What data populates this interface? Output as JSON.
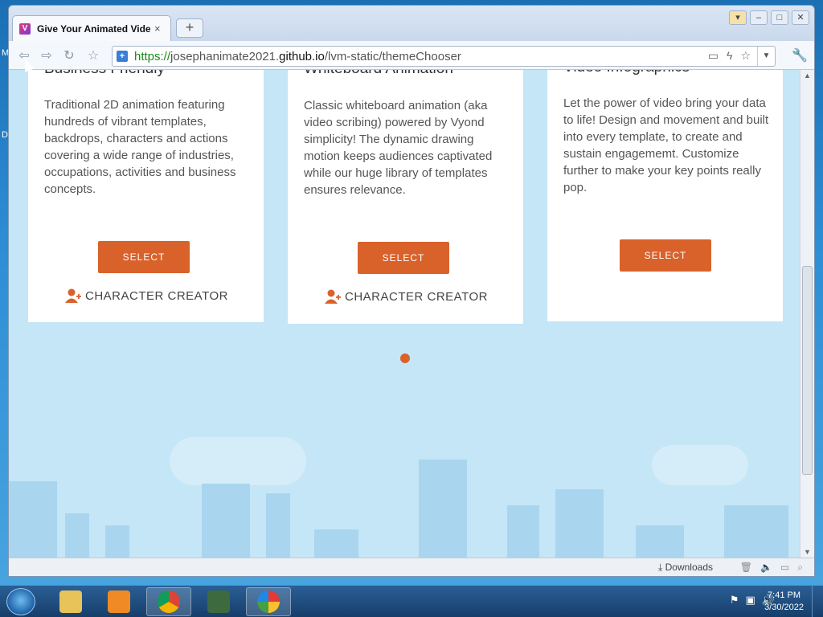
{
  "browser": {
    "tab_title": "Give Your Animated Vide",
    "tab_close": "×",
    "new_tab": "+",
    "url_scheme": "https://",
    "url_host_pre": "josephanimate2021.",
    "url_host": "github.io",
    "url_path": "/lvm-static/themeChooser",
    "downloads_label": "Downloads"
  },
  "cards": [
    {
      "title": "Business Friendly",
      "description": "Traditional 2D animation featuring hundreds of vibrant templates, backdrops, characters and actions covering a wide range of industries, occupations, activities and business concepts.",
      "select_label": "SELECT",
      "creator_label": "CHARACTER CREATOR"
    },
    {
      "title": "Whiteboard Animation",
      "description": "Classic whiteboard animation (aka video scribing) powered by Vyond simplicity! The dynamic drawing motion keeps audiences captivated while our huge library of templates ensures relevance.",
      "select_label": "SELECT",
      "creator_label": "CHARACTER CREATOR"
    },
    {
      "title": "Video Infographics",
      "description": "Let the power of video bring your data to life! Design and movement and built into every template, to create and sustain engagememt. Customize further to make your key points really pop.",
      "select_label": "SELECT"
    }
  ],
  "taskbar": {
    "time": "7:41 PM",
    "date": "3/30/2022"
  },
  "colors": {
    "accent": "#d9622b",
    "content_bg": "#c4e6f6"
  }
}
